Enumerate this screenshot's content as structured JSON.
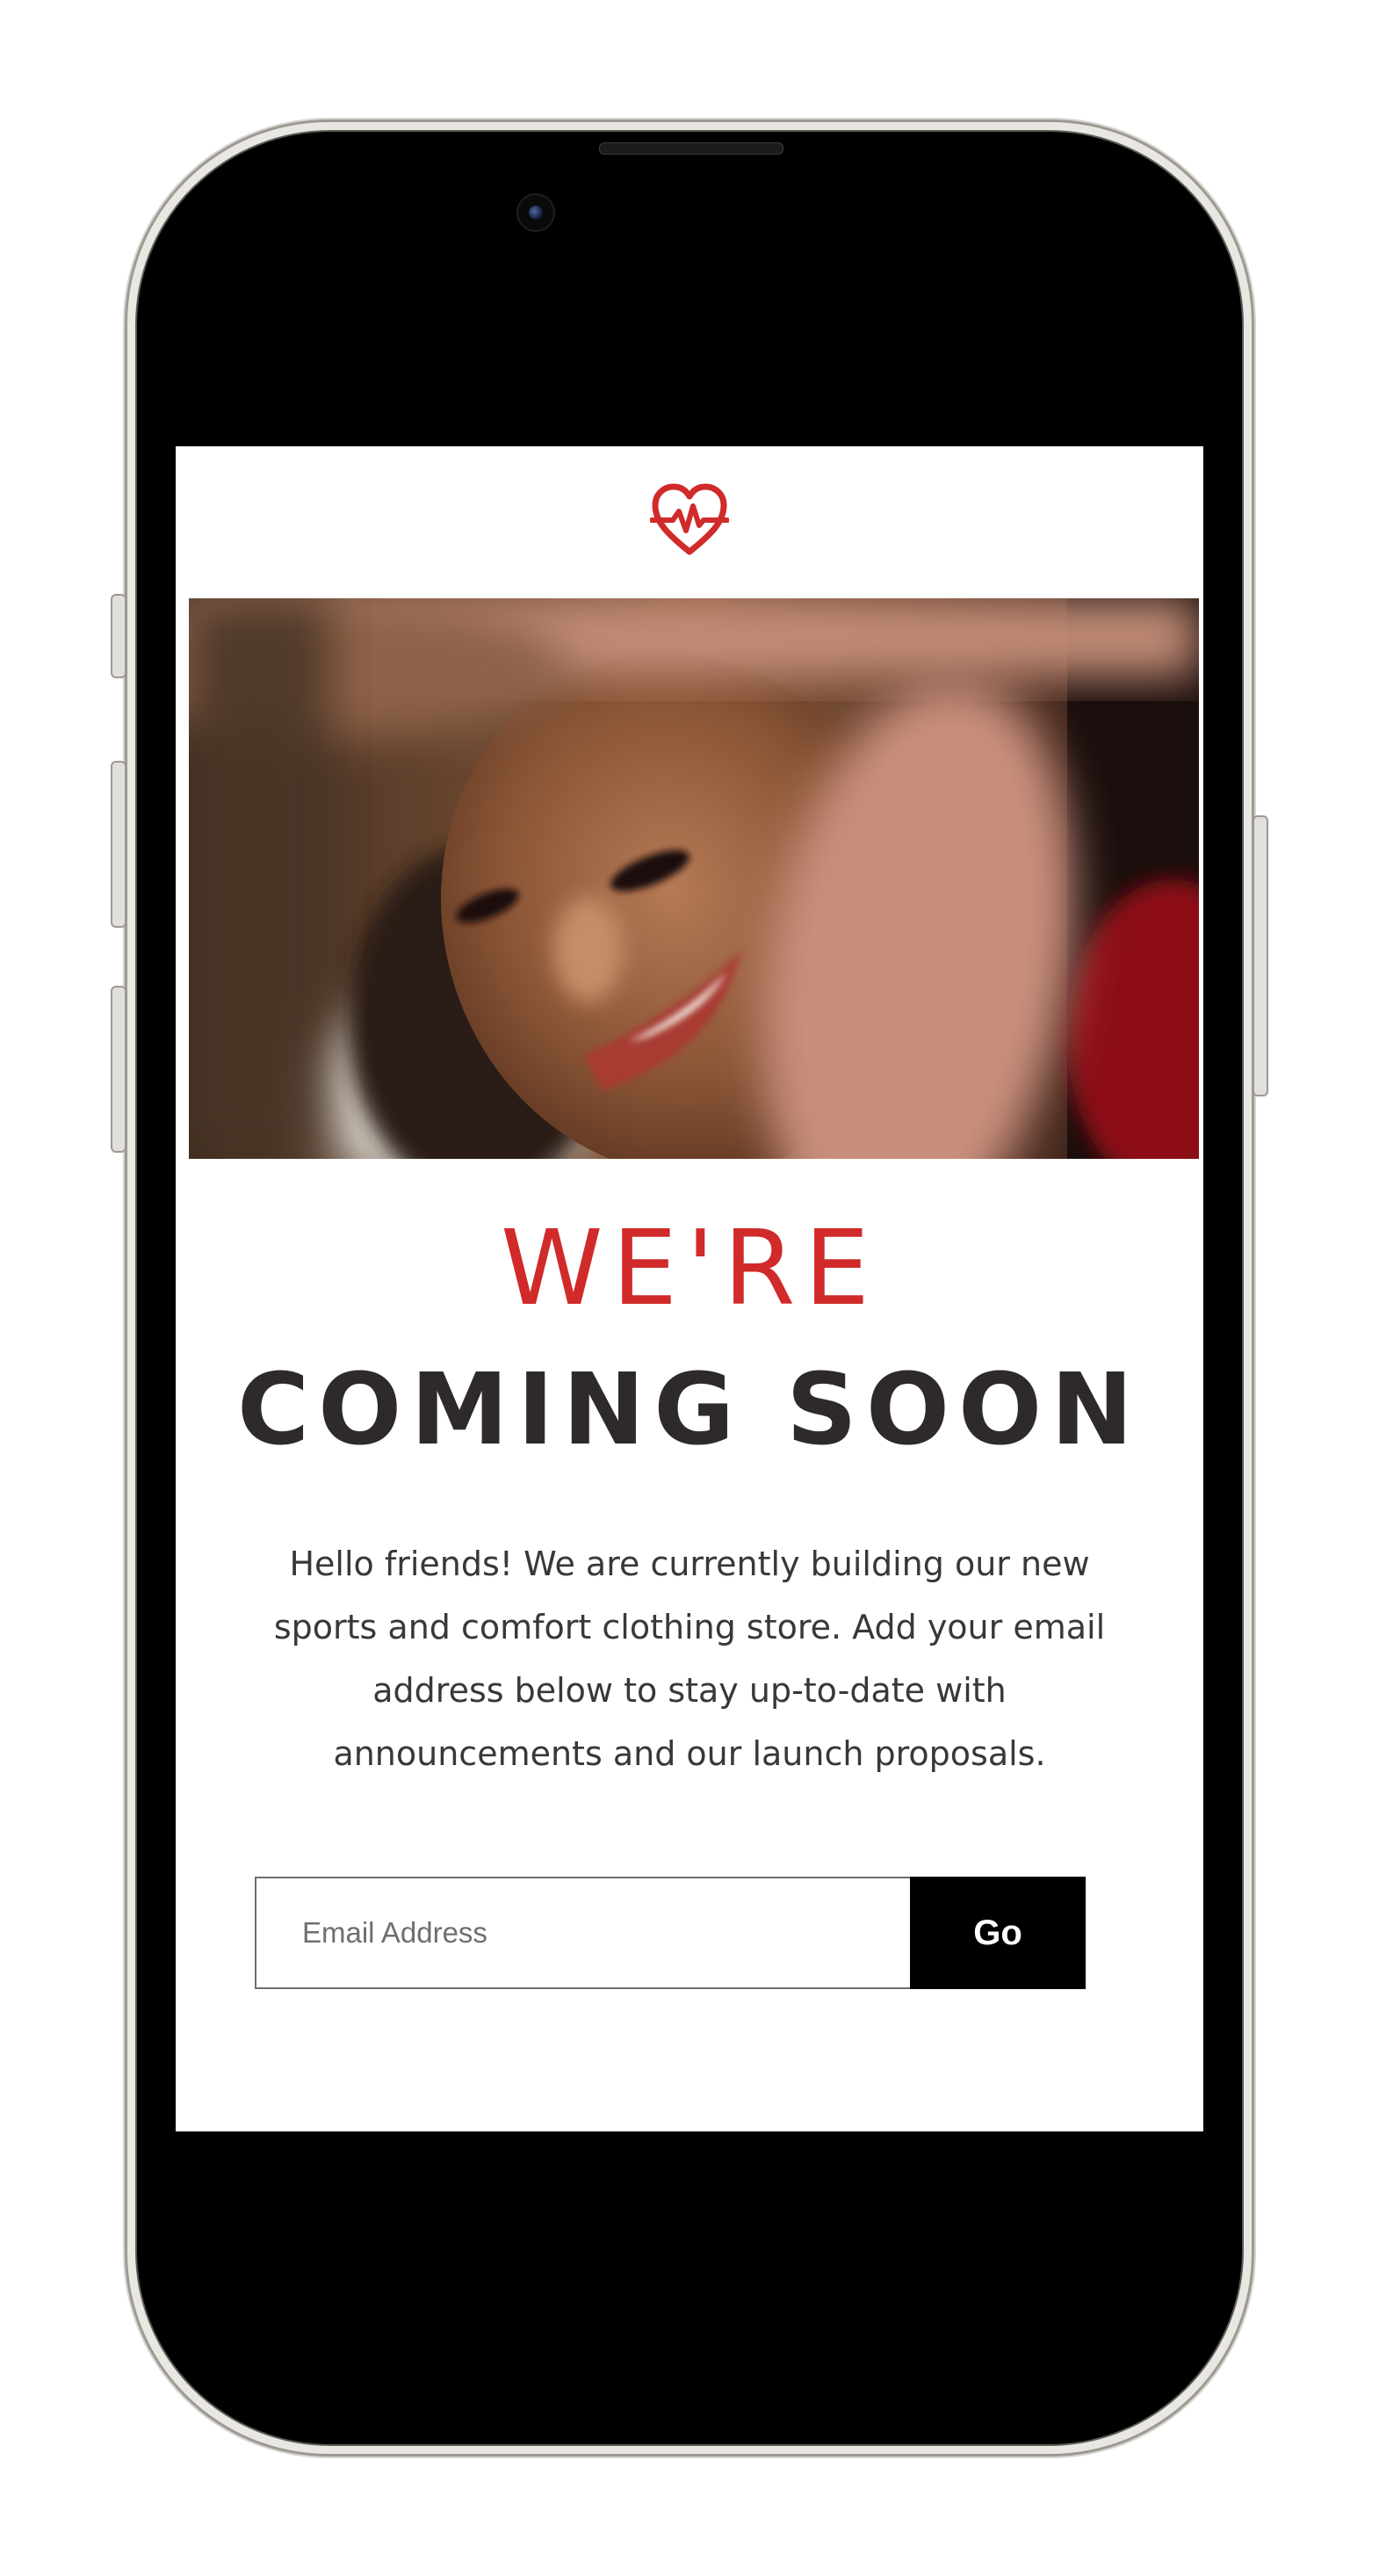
{
  "header": {
    "logo_icon": "heart-pulse-icon",
    "accent_color": "#d12a2a"
  },
  "hero": {
    "image": "smiling-woman-framed-by-hands"
  },
  "headline": {
    "line1": "WE'RE",
    "line2": "COMING SOON"
  },
  "intro": {
    "text": "Hello friends! We are currently building our new sports and comfort clothing store. Add your email address below to stay up-to-date with announcements and our launch proposals."
  },
  "signup": {
    "email_placeholder": "Email Address",
    "email_value": "",
    "submit_label": "Go"
  }
}
